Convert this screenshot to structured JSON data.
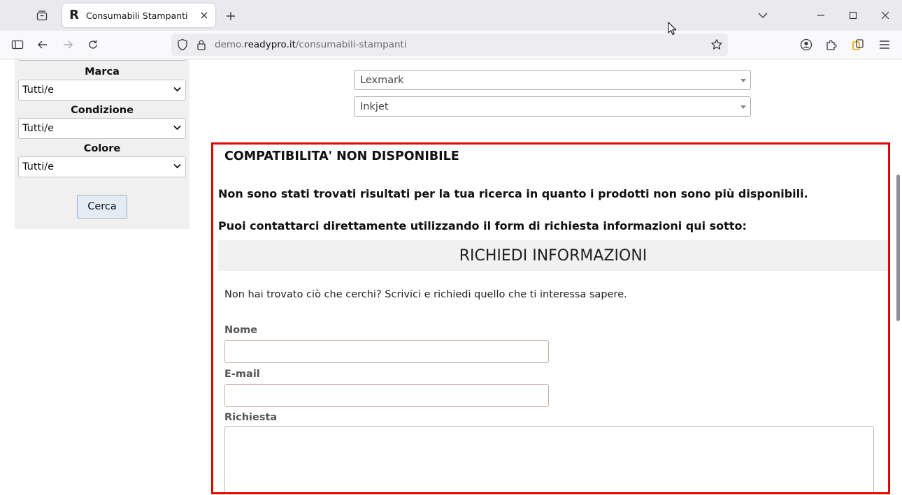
{
  "browser": {
    "tab_title": "Consumabili Stampanti",
    "favicon_letter": "R",
    "url_prefix": "demo.",
    "url_host": "readypro.it",
    "url_path": "/consumabili-stampanti"
  },
  "sidebar": {
    "filters": [
      {
        "label": "Marca",
        "value": "Tutti/e"
      },
      {
        "label": "Condizione",
        "value": "Tutti/e"
      },
      {
        "label": "Colore",
        "value": "Tutti/e"
      }
    ],
    "search_button": "Cerca"
  },
  "selectors": {
    "brand": "Lexmark",
    "type": "Inkjet"
  },
  "notice": {
    "title": "COMPATIBILITA' NON DISPONIBILE",
    "line1": "Non sono stati trovati risultati per la tua ricerca in quanto i prodotti non sono più disponibili.",
    "line2": "Puoi contattarci direttamente utilizzando il form di richiesta informazioni qui sotto:"
  },
  "form": {
    "heading": "RICHIEDI INFORMAZIONI",
    "intro": "Non hai trovato ciò che cerchi? Scrivici e richiedi quello che ti interessa sapere.",
    "name_label": "Nome",
    "email_label": "E-mail",
    "request_label": "Richiesta",
    "name_value": "",
    "email_value": "",
    "request_value": ""
  },
  "colors": {
    "highlight_border": "#e10600",
    "tabbar_bg": "#e9e9ee",
    "sidebar_bg": "#f0f0f0",
    "button_bg": "#e3ebf3"
  },
  "icons": [
    "tab-list-icon",
    "close-icon",
    "plus-icon",
    "chevron-down-icon",
    "minimize-icon",
    "maximize-icon",
    "sidebar-icon",
    "back-icon",
    "forward-icon",
    "reload-icon",
    "shield-icon",
    "lock-icon",
    "star-icon",
    "account-icon",
    "extensions-icon",
    "container-icon",
    "menu-icon"
  ]
}
